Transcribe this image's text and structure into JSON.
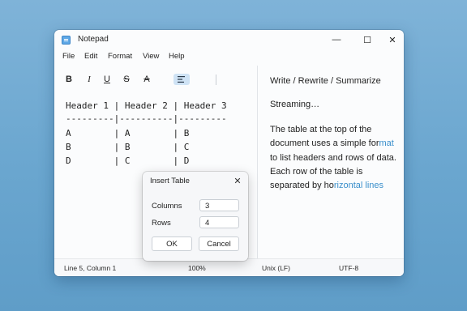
{
  "window": {
    "title": "Notepad",
    "controls": {
      "minimize": "—",
      "maximize": "☐",
      "close": "✕"
    }
  },
  "menu": [
    "File",
    "Edit",
    "Format",
    "View",
    "Help"
  ],
  "toolbar": {
    "bold": "B",
    "italic": "I",
    "underline": "U",
    "strikethrough": "S",
    "clear_format": "A"
  },
  "editor": {
    "lines": [
      "Header 1 | Header 2 | Header 3",
      "---------|----------|---------",
      "A        | A        | B",
      "B        | B        | C",
      "D        | C        | D"
    ]
  },
  "side_panel": {
    "title": "Write / Rewrite / Summarize",
    "status": "Streaming…",
    "text_parts": [
      {
        "text": "The table at the top of the document uses a simple for",
        "highlight": false
      },
      {
        "text": "mat",
        "highlight": true
      },
      {
        "text": " to list headers and rows of data. Each row of the table is separated by ho",
        "highlight": false
      },
      {
        "text": "rizontal lines",
        "highlight": true
      }
    ]
  },
  "status_bar": {
    "position": "Line 5, Column 1",
    "zoom": "100%",
    "line_ending": "Unix (LF)",
    "encoding": "UTF-8"
  },
  "dialog": {
    "title": "Insert Table",
    "columns_label": "Columns",
    "columns_value": "3",
    "rows_label": "Rows",
    "rows_value": "4",
    "ok_label": "OK",
    "cancel_label": "Cancel"
  },
  "colors": {
    "accent": "#3a8fcb",
    "toolbar_active": "#cfe3f5",
    "background": "#6aa6cf"
  }
}
